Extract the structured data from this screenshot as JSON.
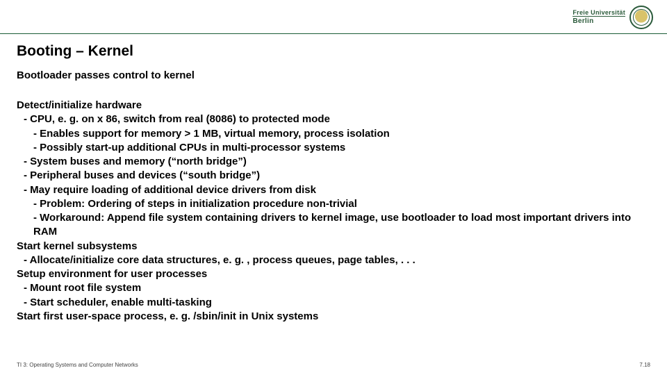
{
  "header": {
    "uni_top": "Freie Universität",
    "uni_bottom": "Berlin"
  },
  "title": "Booting – Kernel",
  "subtitle": "Bootloader passes control to kernel",
  "lines": [
    {
      "level": 0,
      "text": "Detect/initialize hardware"
    },
    {
      "level": 1,
      "text": "- CPU, e. g. on x 86, switch from real (8086) to protected mode"
    },
    {
      "level": 2,
      "text": "- Enables support for memory > 1 MB, virtual memory, process isolation"
    },
    {
      "level": 2,
      "text": "- Possibly start-up additional CPUs in multi-processor systems"
    },
    {
      "level": 1,
      "text": "- System buses and memory (“north bridge”)"
    },
    {
      "level": 1,
      "text": "- Peripheral buses and devices (“south bridge”)"
    },
    {
      "level": 1,
      "text": "- May require loading of additional device drivers from disk"
    },
    {
      "level": 2,
      "text": "- Problem: Ordering of steps in initialization procedure non-trivial"
    },
    {
      "level": 2,
      "text": "- Workaround: Append file system containing drivers to kernel image, use bootloader to load most important drivers into RAM"
    },
    {
      "level": 0,
      "text": "Start kernel subsystems"
    },
    {
      "level": 1,
      "text": "- Allocate/initialize core data structures, e. g. , process queues, page tables, . . ."
    },
    {
      "level": 0,
      "text": "Setup environment for user processes"
    },
    {
      "level": 1,
      "text": "- Mount root file system"
    },
    {
      "level": 1,
      "text": "- Start scheduler, enable multi-tasking"
    },
    {
      "level": 0,
      "text": "Start first user-space process, e. g. /sbin/init in Unix systems"
    }
  ],
  "footer": {
    "left": "TI 3: Operating Systems and Computer Networks",
    "right": "7.18"
  }
}
